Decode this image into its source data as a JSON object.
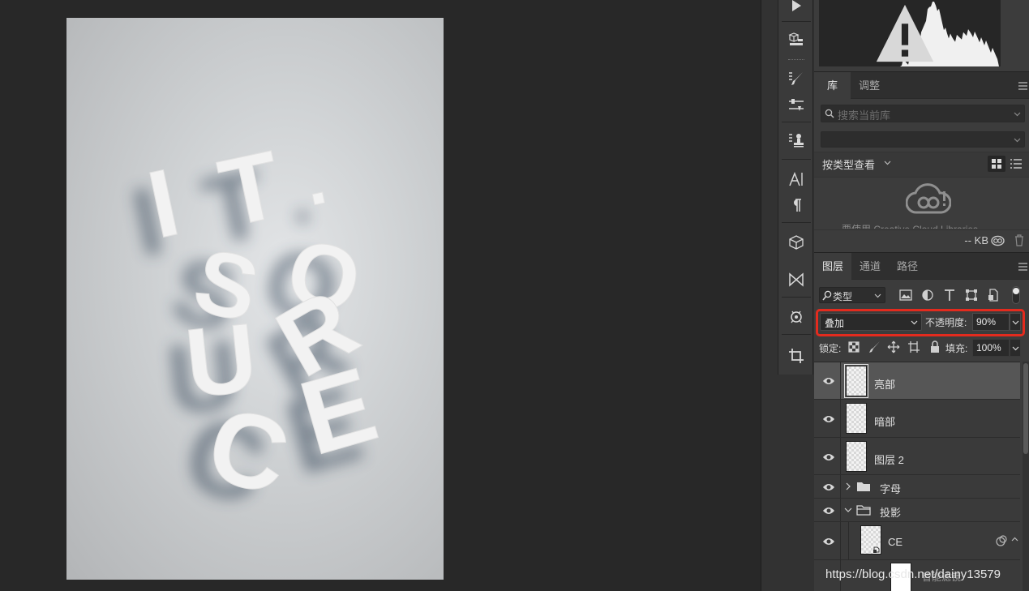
{
  "document": {
    "letters": [
      "I",
      "T",
      ".",
      "S",
      "O",
      "U",
      "R",
      "C",
      "E"
    ],
    "background_colors": [
      "#e3e5e7",
      "#b3b5b7"
    ],
    "letter_color": "#f2f2f2",
    "shadow_color": "#2f3f52"
  },
  "tools": [
    "play-icon",
    "3d-icon",
    "brush-preset-icon",
    "adjust-sliders-icon",
    "clone-source-icon",
    "character-icon",
    "paragraph-icon",
    "3d-cube-icon",
    "bow-tie-icon",
    "actions-icon",
    "crop-icon"
  ],
  "library_panel": {
    "tabs": [
      "库",
      "调整"
    ],
    "search_placeholder": "搜索当前库",
    "view_by_type": "按类型查看",
    "cut_text": "要使用 Creative Cloud Libraries",
    "size_label": "-- KB"
  },
  "layers_panel": {
    "tabs": [
      "图层",
      "通道",
      "路径"
    ],
    "filter_label": "类型",
    "blend_mode": "叠加",
    "opacity_label": "不透明度:",
    "opacity_value": "90%",
    "lock_label": "锁定:",
    "fill_label": "填充:",
    "fill_value": "100%",
    "layers": [
      {
        "name": "亮部",
        "selected": true,
        "type": "pixel"
      },
      {
        "name": "暗部",
        "selected": false,
        "type": "pixel"
      },
      {
        "name": "图层 2",
        "selected": false,
        "type": "pixel"
      },
      {
        "name": "字母",
        "selected": false,
        "type": "group-collapsed"
      },
      {
        "name": "投影",
        "selected": false,
        "type": "group-expanded"
      },
      {
        "name": "CE",
        "selected": false,
        "type": "smart-object"
      }
    ],
    "smart_filter_label": "智能滤镜"
  },
  "watermark": "https://blog.csdn.net/dainy13579",
  "colors": {
    "highlight_outline": "#e32b1e",
    "panel_bg": "#3c3c3c",
    "canvas_bg": "#282828"
  }
}
